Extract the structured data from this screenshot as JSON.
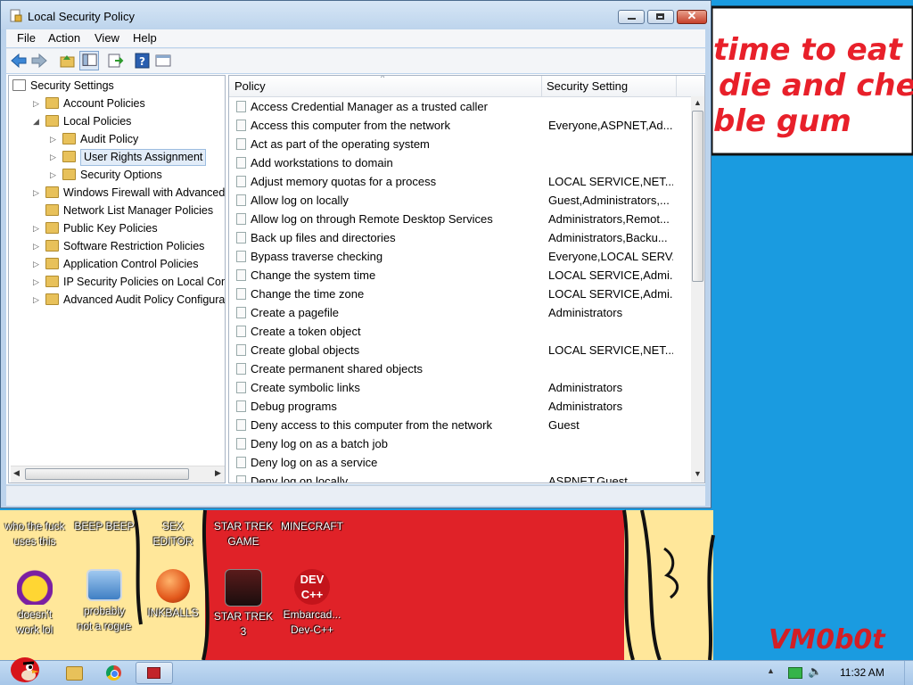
{
  "window": {
    "title": "Local Security Policy",
    "menu": [
      "File",
      "Action",
      "View",
      "Help"
    ]
  },
  "tree": {
    "items": [
      {
        "label": "Security Settings",
        "depth": 0,
        "expanded": true
      },
      {
        "label": "Account Policies",
        "depth": 1,
        "expanded": false
      },
      {
        "label": "Local Policies",
        "depth": 1,
        "expanded": true
      },
      {
        "label": "Audit Policy",
        "depth": 2,
        "expanded": false
      },
      {
        "label": "User Rights Assignment",
        "depth": 2,
        "expanded": false,
        "selected": true
      },
      {
        "label": "Security Options",
        "depth": 2,
        "expanded": false
      },
      {
        "label": "Windows Firewall with Advanced Sec",
        "depth": 1,
        "expanded": false
      },
      {
        "label": "Network List Manager Policies",
        "depth": 1,
        "expanded": false
      },
      {
        "label": "Public Key Policies",
        "depth": 1,
        "expanded": false
      },
      {
        "label": "Software Restriction Policies",
        "depth": 1,
        "expanded": false
      },
      {
        "label": "Application Control Policies",
        "depth": 1,
        "expanded": false
      },
      {
        "label": "IP Security Policies on Local Compu",
        "depth": 1,
        "expanded": false
      },
      {
        "label": "Advanced Audit Policy Configuration",
        "depth": 1,
        "expanded": false
      }
    ]
  },
  "list": {
    "columns": [
      "Policy",
      "Security Setting"
    ],
    "rows": [
      {
        "policy": "Access Credential Manager as a trusted caller",
        "setting": ""
      },
      {
        "policy": "Access this computer from the network",
        "setting": "Everyone,ASPNET,Ad..."
      },
      {
        "policy": "Act as part of the operating system",
        "setting": ""
      },
      {
        "policy": "Add workstations to domain",
        "setting": ""
      },
      {
        "policy": "Adjust memory quotas for a process",
        "setting": "LOCAL SERVICE,NET..."
      },
      {
        "policy": "Allow log on locally",
        "setting": "Guest,Administrators,..."
      },
      {
        "policy": "Allow log on through Remote Desktop Services",
        "setting": "Administrators,Remot..."
      },
      {
        "policy": "Back up files and directories",
        "setting": "Administrators,Backu..."
      },
      {
        "policy": "Bypass traverse checking",
        "setting": "Everyone,LOCAL SERV..."
      },
      {
        "policy": "Change the system time",
        "setting": "LOCAL SERVICE,Admi..."
      },
      {
        "policy": "Change the time zone",
        "setting": "LOCAL SERVICE,Admi..."
      },
      {
        "policy": "Create a pagefile",
        "setting": "Administrators"
      },
      {
        "policy": "Create a token object",
        "setting": ""
      },
      {
        "policy": "Create global objects",
        "setting": "LOCAL SERVICE,NET..."
      },
      {
        "policy": "Create permanent shared objects",
        "setting": ""
      },
      {
        "policy": "Create symbolic links",
        "setting": "Administrators"
      },
      {
        "policy": "Debug programs",
        "setting": "Administrators"
      },
      {
        "policy": "Deny access to this computer from the network",
        "setting": "Guest"
      },
      {
        "policy": "Deny log on as a batch job",
        "setting": ""
      },
      {
        "policy": "Deny log on as a service",
        "setting": ""
      },
      {
        "policy": "Deny log on locally",
        "setting": "ASPNET,Guest"
      }
    ]
  },
  "wallpaper": {
    "lines": [
      "time to eat shit",
      "die and chew",
      "ble gum"
    ],
    "signature": "VM0b0t"
  },
  "desktop_icons": [
    {
      "label": "who the fuck\nuses this",
      "icon": "ie-icon"
    },
    {
      "label": "BEEP BEEP",
      "icon": "app-icon"
    },
    {
      "label": "SEX\nEDITOR",
      "icon": "app-icon"
    },
    {
      "label": "STAR TREK\nGAME",
      "icon": "game-icon"
    },
    {
      "label": "MINECRAFT",
      "icon": "minecraft-icon"
    },
    {
      "label": "doesn't\nwork lol",
      "icon": "yahoo-icon"
    },
    {
      "label": "probably\nnot a rogue",
      "icon": "computer-gear-icon"
    },
    {
      "label": "INKBALLS",
      "icon": "inkball-icon"
    },
    {
      "label": "STAR TREK\n3",
      "icon": "star-wars-icon"
    },
    {
      "label": "Embarcad...\nDev-C++",
      "icon": "devcpp-icon"
    }
  ],
  "taskbar": {
    "clock": "11:32 AM",
    "pinned": [
      "explorer-icon",
      "chrome-icon",
      "security-policy-icon"
    ]
  },
  "colors": {
    "desktop": "#1a9be0",
    "wall_red": "#e8202a",
    "wall_yellow": "#ffe79a"
  }
}
